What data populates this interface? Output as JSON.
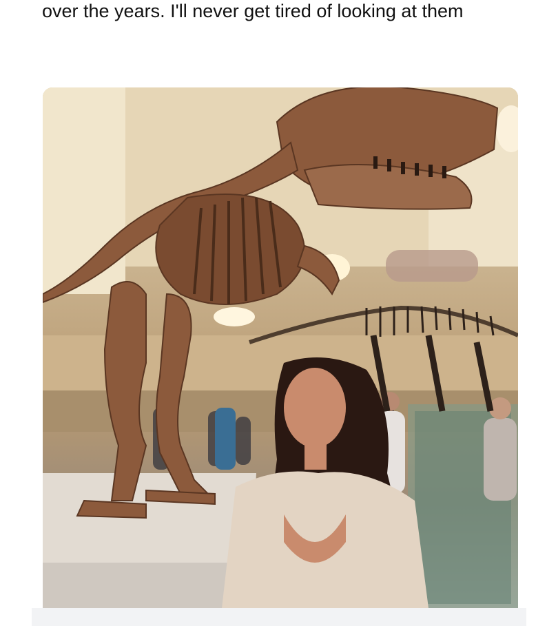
{
  "post": {
    "caption": "over the years. I'll never get tired of looking at them"
  },
  "image": {
    "subject": "photo"
  }
}
